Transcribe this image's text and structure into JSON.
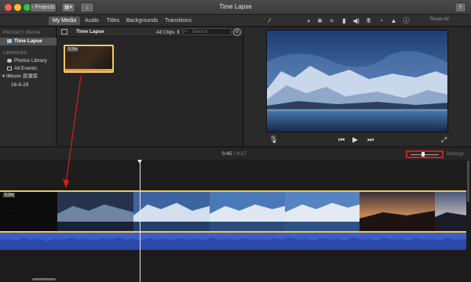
{
  "window": {
    "title": "Time Lapse",
    "projects_button": "Projects"
  },
  "tabs": [
    {
      "label": "My Media",
      "active": true
    },
    {
      "label": "Audio",
      "active": false
    },
    {
      "label": "Titles",
      "active": false
    },
    {
      "label": "Backgrounds",
      "active": false
    },
    {
      "label": "Transitions",
      "active": false
    }
  ],
  "toolbar": {
    "reset_all": "Reset All",
    "icons": [
      "magic-wand-icon",
      "color-balance-icon",
      "color-correction-icon",
      "crop-icon",
      "stabilization-icon",
      "volume-icon",
      "audio-eq-icon",
      "speed-icon",
      "noise-reduction-icon",
      "info-icon"
    ]
  },
  "sidebar": {
    "project_media_header": "PROJECT MEDIA",
    "project_item": "Time Lapse",
    "libraries_header": "LIBRARIES",
    "libraries": [
      {
        "label": "Photos Library"
      },
      {
        "label": "All Events"
      },
      {
        "label": "iMovie 资源库"
      },
      {
        "label": "16-8-29"
      }
    ]
  },
  "browser": {
    "title": "Time Lapse",
    "filter": "All Clips",
    "search_placeholder": "Search",
    "clip_duration": "9.2m"
  },
  "timeline": {
    "current_time": "0:45",
    "total_time": "9:17",
    "settings_label": "Settings",
    "clip_badge": "9.2m",
    "zoom_level": 0.45
  },
  "colors": {
    "accent_yellow": "#f2c550",
    "annotation_red": "#d41f1f",
    "audio_blue": "#3b5ec7"
  }
}
